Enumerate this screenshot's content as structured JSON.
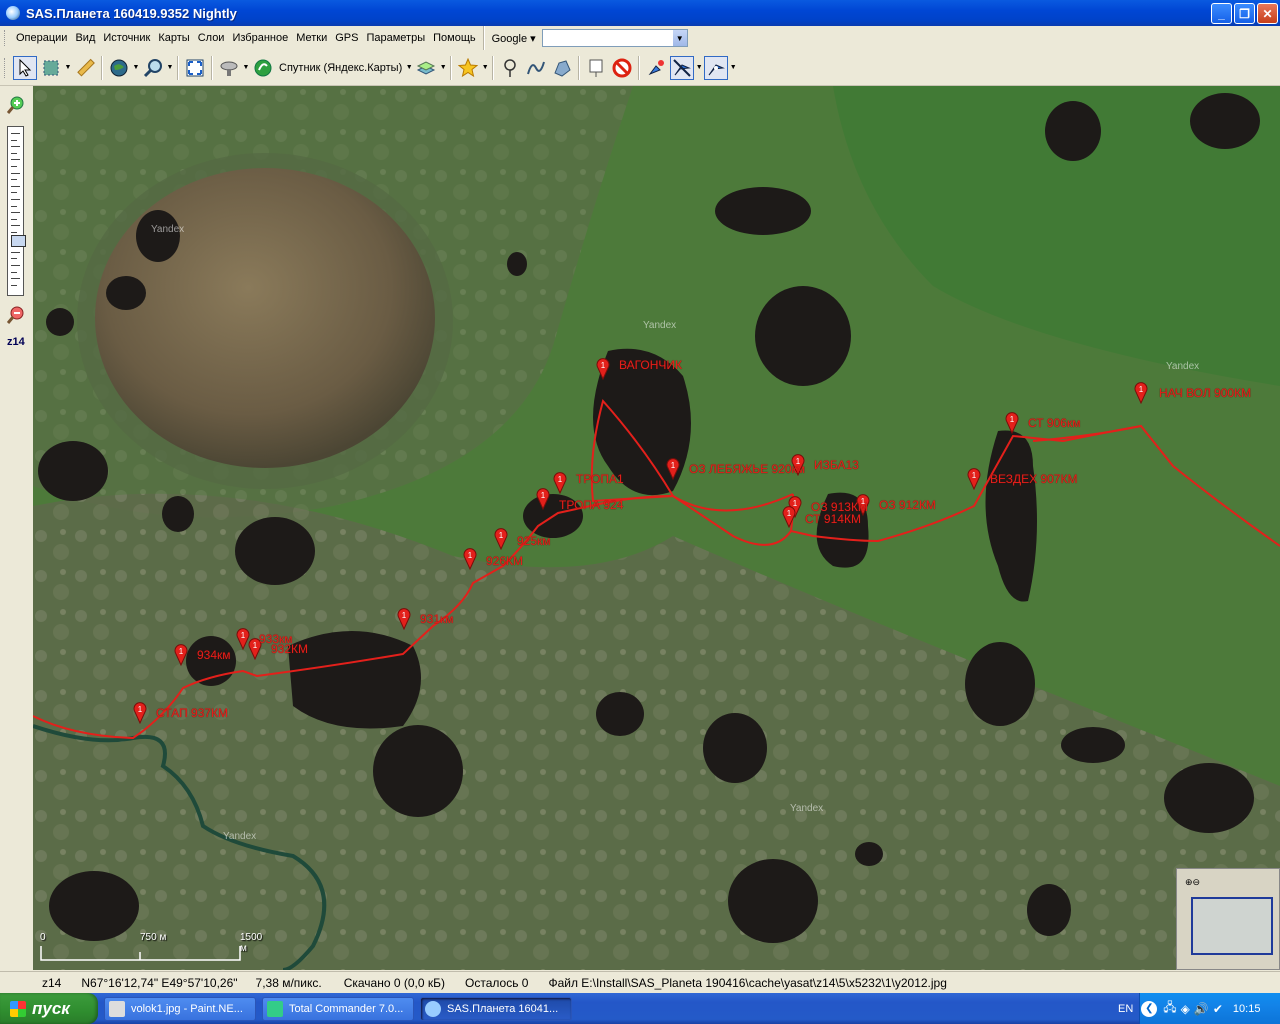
{
  "window": {
    "title": "SAS.Планета 160419.9352 Nightly",
    "minimize_label": "_",
    "maximize_label": "❐",
    "close_label": "✕"
  },
  "menu": {
    "items": [
      "Операции",
      "Вид",
      "Источник",
      "Карты",
      "Слои",
      "Избранное",
      "Метки",
      "GPS",
      "Параметры",
      "Помощь"
    ],
    "search_provider": "Google",
    "search_value": ""
  },
  "toolbar": {
    "map_source_label": "Спутник (Яндекс.Карты)"
  },
  "zoom": {
    "plus_icon": "zoom-in-icon",
    "minus_icon": "zoom-out-icon",
    "level_label": "z14"
  },
  "map": {
    "watermarks": [
      "Yandex",
      "Yandex",
      "Yandex",
      "Yandex",
      "Yandex"
    ],
    "placemarks": [
      {
        "label": "ВАГОНЧИК"
      },
      {
        "label": "НАЧ ВОЛ 900КМ"
      },
      {
        "label": "СТ 906км"
      },
      {
        "label": "ВЕЗДЕХ 907КМ"
      },
      {
        "label": "ИЗБА13"
      },
      {
        "label": "ОЗ 912КМ"
      },
      {
        "label": "ОЗ 913КМ"
      },
      {
        "label": "СТ 914КМ"
      },
      {
        "label": "ОЗ ЛЕБЯЖЬЕ 920км"
      },
      {
        "label": "ТРОПА1"
      },
      {
        "label": "ТРОПА 924"
      },
      {
        "label": "925км"
      },
      {
        "label": "926КМ"
      },
      {
        "label": "931км"
      },
      {
        "label": "932КМ"
      },
      {
        "label": "933км"
      },
      {
        "label": "934км"
      },
      {
        "label": "СТАП 937КМ"
      }
    ],
    "route_color": "#e3201b",
    "scale": {
      "zero": "0",
      "mid": "750 м",
      "end": "1500 м"
    }
  },
  "status": {
    "zoom": "z14",
    "coords": "N67°16'12,74\" E49°57'10,26\"",
    "resolution": "7,38 м/пикс.",
    "downloaded": "Скачано 0 (0,0 кБ)",
    "remaining": "Осталось 0",
    "file": "Файл E:\\Install\\SAS_Planeta 190416\\cache\\yasat\\z14\\5\\x5232\\1\\y2012.jpg"
  },
  "taskbar": {
    "start_label": "пуск",
    "tasks": [
      {
        "label": "volok1.jpg - Paint.NE..."
      },
      {
        "label": "Total Commander 7.0..."
      },
      {
        "label": "SAS.Планета 16041..."
      }
    ],
    "lang": "EN",
    "time": "10:15"
  }
}
